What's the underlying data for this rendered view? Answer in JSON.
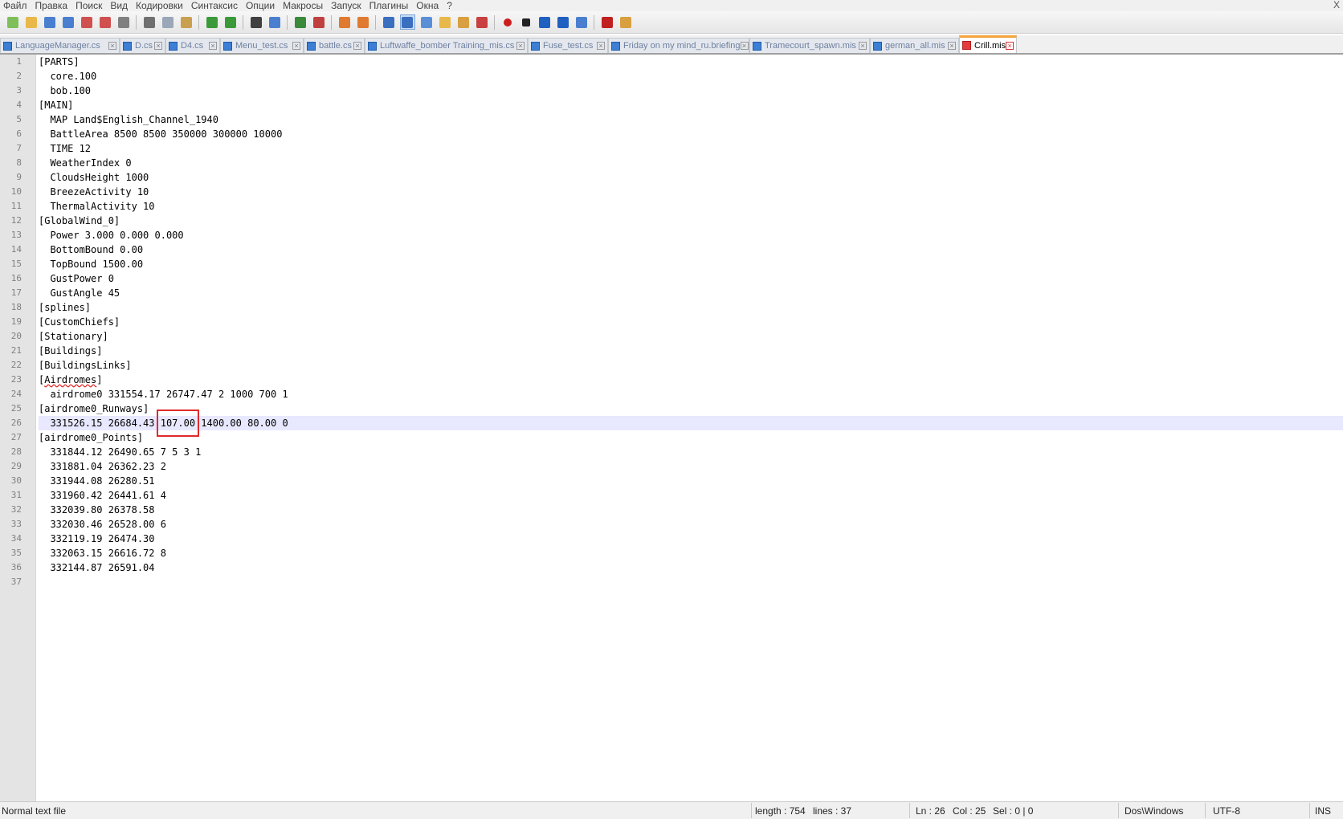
{
  "menu": [
    "Файл",
    "Правка",
    "Поиск",
    "Вид",
    "Кодировки",
    "Синтаксис",
    "Опции",
    "Макросы",
    "Запуск",
    "Плагины",
    "Окна",
    "?"
  ],
  "window_close": "X",
  "toolbar": {
    "icons": [
      "new-file-icon",
      "open-file-icon",
      "save-icon",
      "save-all-icon",
      "close-icon",
      "close-all-icon",
      "print-icon",
      "cut-icon",
      "copy-icon",
      "paste-icon",
      "undo-icon",
      "redo-icon",
      "find-icon",
      "replace-icon",
      "zoom-in-icon",
      "zoom-out-icon",
      "sync-vertical-icon",
      "sync-horizontal-icon",
      "word-wrap-icon",
      "show-all-chars-icon",
      "indent-guide-icon",
      "function-list-icon",
      "folder-icon",
      "doc-map-icon",
      "record-macro-icon",
      "stop-macro-icon",
      "play-macro-icon",
      "run-macro-multiple-icon",
      "save-macro-icon",
      "spellcheck-icon",
      "plugin-icon"
    ],
    "colors": {
      "accent": "#f4a33d",
      "macro_red": "#cc1d1d",
      "spell_red": "#e02020"
    }
  },
  "tabs": [
    {
      "label": "LanguageManager.cs",
      "active": false
    },
    {
      "label": "D.cs",
      "active": false
    },
    {
      "label": "D4.cs",
      "active": false
    },
    {
      "label": "Menu_test.cs",
      "active": false
    },
    {
      "label": "battle.cs",
      "active": false
    },
    {
      "label": "Luftwaffe_bomber Training_mis.cs",
      "active": false
    },
    {
      "label": "Fuse_test.cs",
      "active": false
    },
    {
      "label": "Friday on my mind_ru.briefing",
      "active": false
    },
    {
      "label": "Tramecourt_spawn.mis",
      "active": false
    },
    {
      "label": "german_all.mis",
      "active": false
    },
    {
      "label": "Crill.mis",
      "active": true
    }
  ],
  "editor": {
    "lines": [
      "[PARTS]",
      "  core.100",
      "  bob.100",
      "[MAIN]",
      "  MAP Land$English_Channel_1940",
      "  BattleArea 8500 8500 350000 300000 10000",
      "  TIME 12",
      "  WeatherIndex 0",
      "  CloudsHeight 1000",
      "  BreezeActivity 10",
      "  ThermalActivity 10",
      "[GlobalWind_0]",
      "  Power 3.000 0.000 0.000",
      "  BottomBound 0.00",
      "  TopBound 1500.00",
      "  GustPower 0",
      "  GustAngle 45",
      "[splines]",
      "[CustomChiefs]",
      "[Stationary]",
      "[Buildings]",
      "[BuildingsLinks]",
      "[Airdromes]",
      "  airdrome0 331554.17 26747.47 2 1000 700 1",
      "[airdrome0_Runways]",
      "  331526.15 26684.43 107.00 1400.00 80.00 0",
      "[airdrome0_Points]",
      "  331844.12 26490.65 7 5 3 1",
      "  331881.04 26362.23 2",
      "  331944.08 26280.51",
      "  331960.42 26441.61 4",
      "  332039.80 26378.58",
      "  332030.46 26528.00 6",
      "  332119.19 26474.30",
      "  332063.15 26616.72 8",
      "  332144.87 26591.04",
      ""
    ],
    "current_line": 26,
    "highlighted_value": "107.00",
    "spellcheck_word": "Airdromes"
  },
  "status": {
    "file_type": "Normal text file",
    "length": "length : 754",
    "lines": "lines : 37",
    "ln": "Ln : 26",
    "col": "Col : 25",
    "sel": "Sel : 0 | 0",
    "eol": "Dos\\Windows",
    "encoding": "UTF-8",
    "mode": "INS"
  }
}
